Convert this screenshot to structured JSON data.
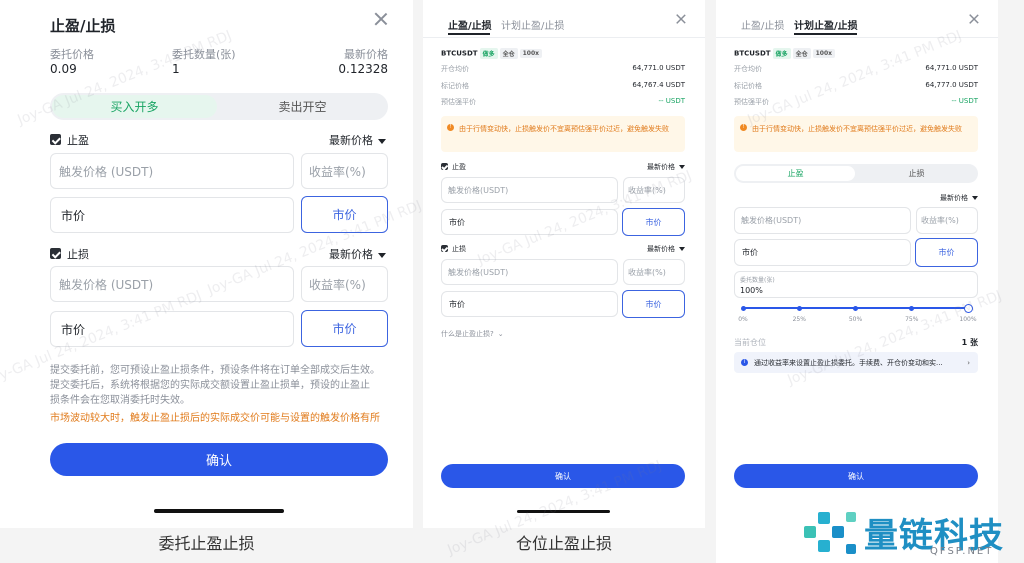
{
  "panel1": {
    "title": "止盈/止损",
    "cols": [
      {
        "label": "委托价格",
        "value": "0.09"
      },
      {
        "label": "委托数量(张)",
        "value": "1"
      },
      {
        "label": "最新价格",
        "value": "0.12328"
      }
    ],
    "side_tabs": [
      "买入开多",
      "卖出开空"
    ],
    "take_profit": {
      "label": "止盈",
      "price_type": "最新价格",
      "trigger_placeholder": "触发价格 (USDT)",
      "rate_placeholder": "收益率(%)",
      "market_label": "市价",
      "market_btn": "市价"
    },
    "stop_loss": {
      "label": "止损",
      "price_type": "最新价格",
      "trigger_placeholder": "触发价格 (USDT)",
      "rate_placeholder": "收益率(%)",
      "market_label": "市价",
      "market_btn": "市价"
    },
    "notes": [
      "提交委托前，您可预设止盈止损条件，预设条件将在订单全部成交后生效。",
      "提交委托后，系统将根据您的实际成交额设置止盈止损单，预设的止盈止",
      "损条件会在您取消委托时失效。"
    ],
    "warning": "市场波动较大时，触发止盈止损后的实际成交价可能与设置的触发价格有所",
    "confirm": "确认",
    "caption": "委托止盈止损"
  },
  "panel2": {
    "tabs": [
      "止盈/止损",
      "计划止盈/止损"
    ],
    "symbol": "BTCUSDT",
    "tags": [
      "做多",
      "全仓",
      "100x"
    ],
    "rows": [
      {
        "label": "开仓均价",
        "value": "64,771.0 USDT"
      },
      {
        "label": "标记价格",
        "value": "64,767.4 USDT"
      },
      {
        "label": "预估强平价",
        "value": "-- USDT"
      }
    ],
    "warning": "由于行情变动快，止损触发价不宜离预估强平价过近，避免触发失败",
    "take_profit": {
      "label": "止盈",
      "price_type": "最新价格",
      "trigger_placeholder": "触发价格(USDT)",
      "rate_placeholder": "收益率(%)",
      "market_label": "市价",
      "market_btn": "市价"
    },
    "stop_loss": {
      "label": "止损",
      "price_type": "最新价格",
      "trigger_placeholder": "触发价格(USDT)",
      "rate_placeholder": "收益率(%)",
      "market_label": "市价",
      "market_btn": "市价"
    },
    "help": "什么是止盈止损?",
    "confirm": "确认",
    "caption": "仓位止盈止损"
  },
  "panel3": {
    "tabs": [
      "止盈/止损",
      "计划止盈/止损"
    ],
    "symbol": "BTCUSDT",
    "tags": [
      "做多",
      "全仓",
      "100x"
    ],
    "rows": [
      {
        "label": "开仓均价",
        "value": "64,771.0 USDT"
      },
      {
        "label": "标记价格",
        "value": "64,777.0 USDT"
      },
      {
        "label": "预估强平价",
        "value": "-- USDT"
      }
    ],
    "warning": "由于行情变动快，止损触发价不宜离预估强平价过近，避免触发失败",
    "seg": [
      "止盈",
      "止损"
    ],
    "price_type": "最新价格",
    "trigger_placeholder": "触发价格(USDT)",
    "rate_placeholder": "收益率(%)",
    "market_label": "市价",
    "market_btn": "市价",
    "qty_label": "委托数量(张)",
    "qty_value": "100%",
    "slider_value": 1.0,
    "slider_marks": [
      "0%",
      "25%",
      "50%",
      "75%",
      "100%"
    ],
    "position_label": "当前仓位",
    "position_value": "1 张",
    "info": "通过收益率来设置止盈止损委托。手续费、开仓价变动和实...",
    "confirm": "确认"
  },
  "brand": {
    "name": "量链科技",
    "domain": "QFSP.NET"
  },
  "watermark": "Joy-GA Jul 24, 2024, 3:41 PM RDJ",
  "colors": {
    "primary": "#2a57e8",
    "green": "#19a463",
    "warn": "#e07a1a"
  }
}
